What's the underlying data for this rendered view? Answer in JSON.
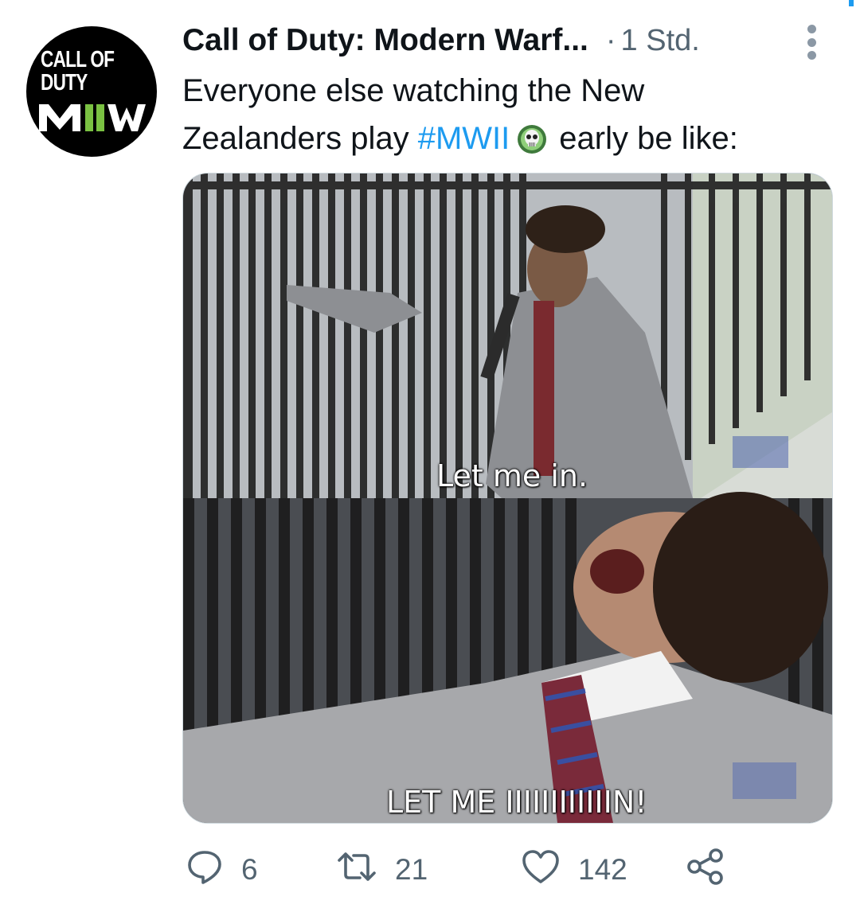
{
  "tweet": {
    "author": "Call of Duty: Modern Warf...",
    "separator": "·",
    "time": "1 Std.",
    "avatar": {
      "brand_top": "CALL OF DUTY",
      "brand_bottom": "MII"
    },
    "text": {
      "line1": "Everyone else watching the New",
      "line2_prefix": "Zealanders play ",
      "hashtag": "#MWII",
      "line2_suffix": "early be like:"
    },
    "emoji": "ghost-skull-icon",
    "media": {
      "caption_top": "Let me in.",
      "caption_bottom": "LET ME IIIIIIIIIIIIN!"
    },
    "actions": {
      "replies": "6",
      "retweets": "21",
      "likes": "142"
    }
  },
  "colors": {
    "hashtag": "#1d9bf0",
    "secondary_text": "#536471",
    "primary_text": "#0f1419",
    "avatar_green": "#7ac142"
  }
}
